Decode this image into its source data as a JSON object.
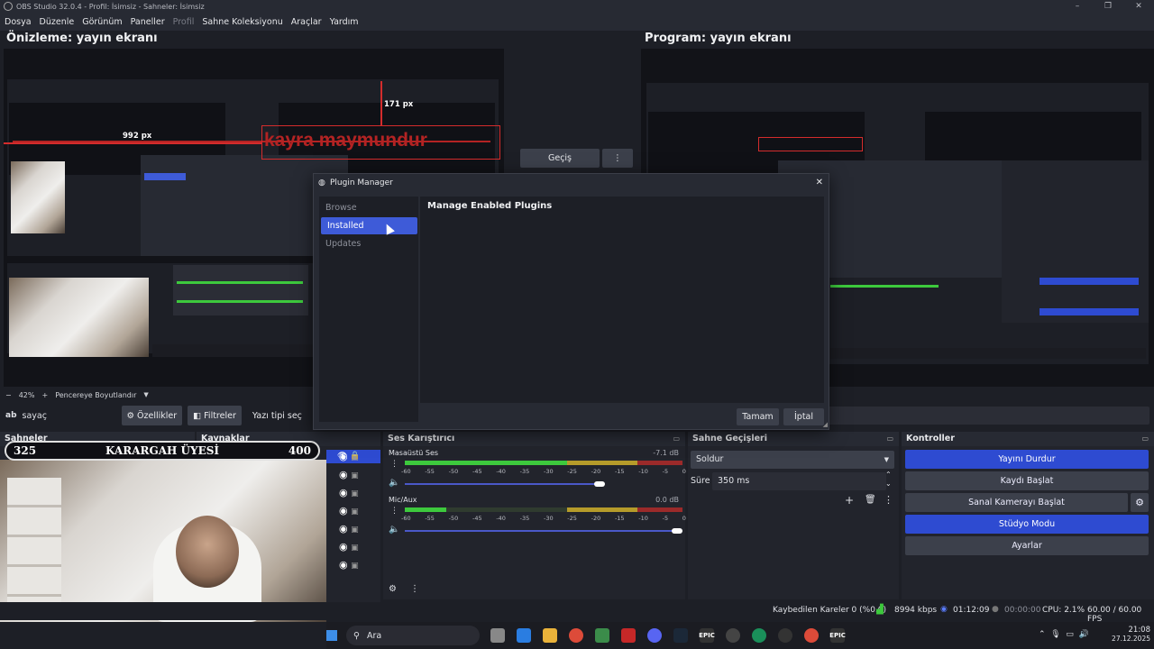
{
  "window": {
    "title": "OBS Studio 32.0.4 - Profil: İsimsiz - Sahneler: İsimsiz",
    "controls": [
      "–",
      "❐",
      "✕"
    ]
  },
  "menu": {
    "items": [
      "Dosya",
      "Düzenle",
      "Görünüm",
      "Paneller",
      "Profil",
      "Sahne Koleksiyonu",
      "Araçlar",
      "Yardım"
    ]
  },
  "preview": {
    "title": "Önizleme: yayın ekranı",
    "overlay_text": "kayra maymundur",
    "width_label": "992 px",
    "top_label": "171 px",
    "zoom": "42%",
    "fit_label": "Pencereye Boyutlandır"
  },
  "program": {
    "title": "Program: yayın ekranı"
  },
  "transition": {
    "button": "Geçiş",
    "more": "⋮"
  },
  "source_toolbar": {
    "source_name": "sayaç",
    "properties": "Özellikler",
    "filters": "Filtreler",
    "font_select": "Yazı tipi seç"
  },
  "counter_bar": {
    "left": "325",
    "center": "KARARGAH ÜYESİ",
    "right": "400"
  },
  "panels": {
    "scenes": "Sahneler",
    "sources": "Kaynaklar",
    "mixer": "Ses Karıştırıcı",
    "transitions": "Sahne Geçişleri",
    "controls": "Kontroller"
  },
  "mixer": {
    "ticks": [
      "-60",
      "-55",
      "-50",
      "-45",
      "-40",
      "-35",
      "-30",
      "-25",
      "-20",
      "-15",
      "-10",
      "-5",
      "0"
    ],
    "channels": [
      {
        "name": "Masaüstü Ses",
        "db": "-7.1 dB",
        "level": 0.6,
        "volume": 0.72
      },
      {
        "name": "Mic/Aux",
        "db": "0.0 dB",
        "level": 0.15,
        "volume": 1.0
      }
    ]
  },
  "transitions": {
    "selected": "Soldur",
    "duration_label": "Süre",
    "duration_value": "350 ms"
  },
  "controls": {
    "stop_stream": "Yayını Durdur",
    "start_record": "Kaydı Başlat",
    "virtual_cam": "Sanal Kamerayı Başlat",
    "studio_mode": "Stüdyo Modu",
    "settings": "Ayarlar"
  },
  "status": {
    "dropped": "Kaybedilen Kareler 0 (%0.0)",
    "bitrate": "8994 kbps",
    "stream_time": "01:12:09",
    "rec_time": "00:00:00",
    "cpu": "CPU: 2.1%",
    "fps": "60.00 / 60.00 FPS"
  },
  "dialog": {
    "title": "Plugin Manager",
    "nav": [
      "Browse",
      "Installed",
      "Updates"
    ],
    "heading": "Manage Enabled Plugins",
    "ok": "Tamam",
    "cancel": "İptal"
  },
  "taskbar": {
    "search_placeholder": "Ara",
    "time": "21:08",
    "date": "27.12.2025"
  },
  "colors": {
    "accent": "#3e5bd8",
    "stream_active": "#2e4bd1",
    "overlay_red": "#d42c2c"
  }
}
